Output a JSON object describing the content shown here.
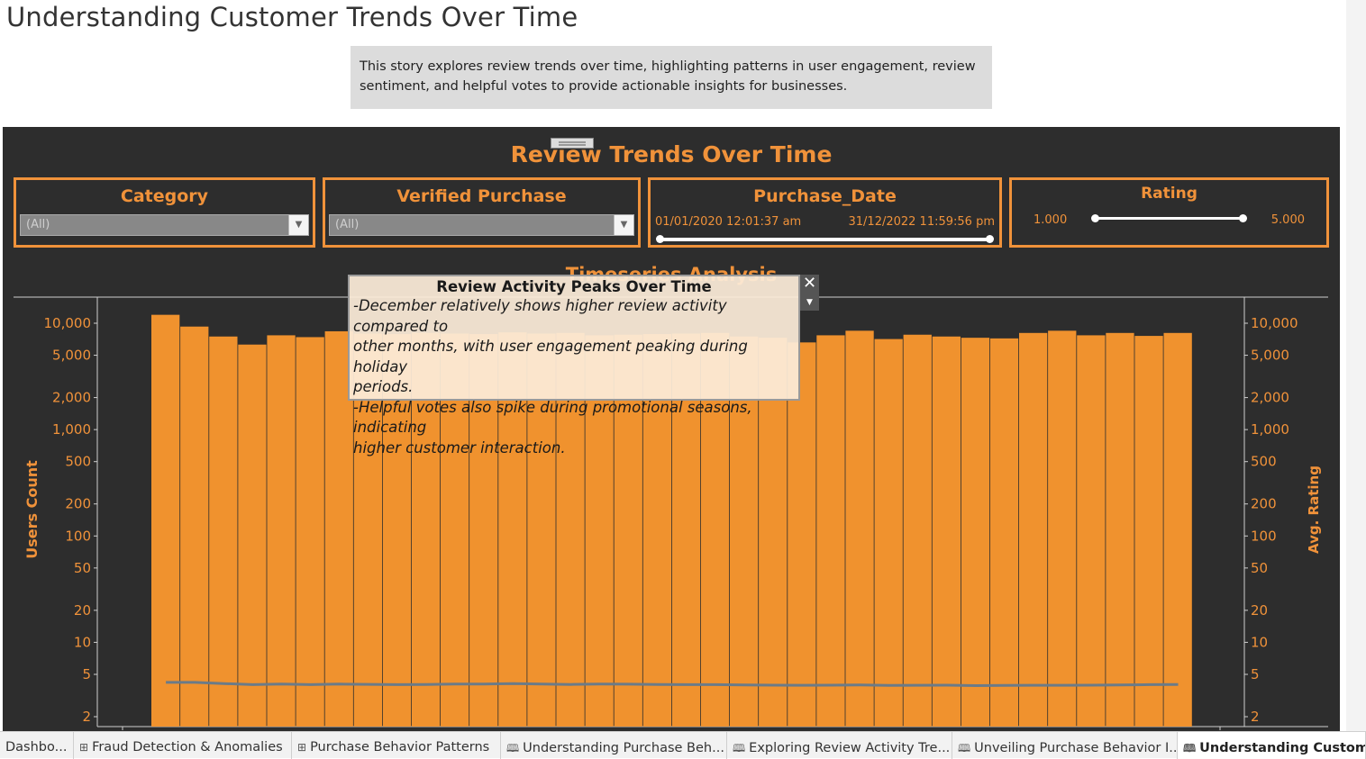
{
  "page": {
    "title": "Understanding Customer Trends Over Time",
    "description": "This story explores review trends over time, highlighting patterns in user engagement, review sentiment, and helpful votes to provide actionable insights for businesses."
  },
  "dashboard": {
    "title": "Review Trends Over Time",
    "section_title": "Timeseries Analysis",
    "accent_color": "#f0923a",
    "background_color": "#2d2d2d",
    "filters": {
      "category": {
        "title": "Category",
        "value": "(All)"
      },
      "verified": {
        "title": "Verified Purchase",
        "value": "(All)"
      },
      "purchase_date": {
        "title": "Purchase_Date",
        "start": "01/01/2020 12:01:37 am",
        "end": "31/12/2022 11:59:56 pm"
      },
      "rating": {
        "title": "Rating",
        "min": "1.000",
        "max": "5.000"
      }
    }
  },
  "tooltip": {
    "title": "Review Activity Peaks Over Time",
    "line1": "-December relatively shows higher review activity compared to",
    "line2": "other months, with user engagement peaking during holiday",
    "line3": "periods.",
    "line4": "-Helpful votes also spike during promotional seasons, indicating",
    "line5": "higher customer interaction.",
    "close_icon": "close-icon",
    "more_icon": "chevron-down-icon"
  },
  "chart_data": {
    "type": "bar",
    "scale": "log",
    "left_axis_label": "Users Count",
    "right_axis_label": "Avg. Rating",
    "ticks": [
      10000,
      5000,
      2000,
      1000,
      500,
      200,
      100,
      50,
      20,
      10,
      5,
      2
    ],
    "tick_labels": [
      "10,000",
      "5,000",
      "2,000",
      "1,000",
      "500",
      "200",
      "100",
      "50",
      "20",
      "10",
      "5",
      "2"
    ],
    "ylim": [
      1.4,
      15000
    ],
    "bar_color": "#f0922e",
    "line_color": "#6b7b88",
    "series": [
      {
        "name": "Users Count",
        "type": "bar",
        "values": [
          12000,
          9300,
          7500,
          6300,
          7700,
          7400,
          8400,
          8000,
          7900,
          8100,
          8000,
          7900,
          8200,
          8000,
          8100,
          7700,
          7800,
          7900,
          8000,
          8100,
          7500,
          7300,
          6600,
          7700,
          8500,
          7100,
          7800,
          7500,
          7300,
          7200,
          8100,
          8500,
          7700,
          8100,
          7600,
          8100
        ]
      },
      {
        "name": "Avg. Rating",
        "type": "line",
        "values": [
          4.2,
          4.2,
          4.1,
          4.0,
          4.05,
          4.0,
          4.05,
          4.03,
          4.0,
          4.02,
          4.05,
          4.05,
          4.1,
          4.06,
          4.02,
          4.05,
          4.04,
          4.01,
          4.0,
          4.0,
          3.98,
          3.96,
          3.95,
          3.96,
          3.97,
          3.93,
          3.95,
          3.96,
          3.92,
          3.93,
          3.95,
          3.95,
          3.96,
          3.97,
          4.0,
          4.02
        ]
      }
    ]
  },
  "tabs": [
    {
      "label": "Dashbo...",
      "icon": ""
    },
    {
      "label": "Fraud Detection & Anomalies",
      "icon": "grid-icon"
    },
    {
      "label": "Purchase Behavior Patterns",
      "icon": "grid-icon"
    },
    {
      "label": "Understanding Purchase Beh...",
      "icon": "story-icon"
    },
    {
      "label": "Exploring Review Activity Tre...",
      "icon": "story-icon"
    },
    {
      "label": "Unveiling Purchase Behavior I...",
      "icon": "story-icon"
    },
    {
      "label": "Understanding Customer",
      "icon": "story-icon"
    }
  ]
}
